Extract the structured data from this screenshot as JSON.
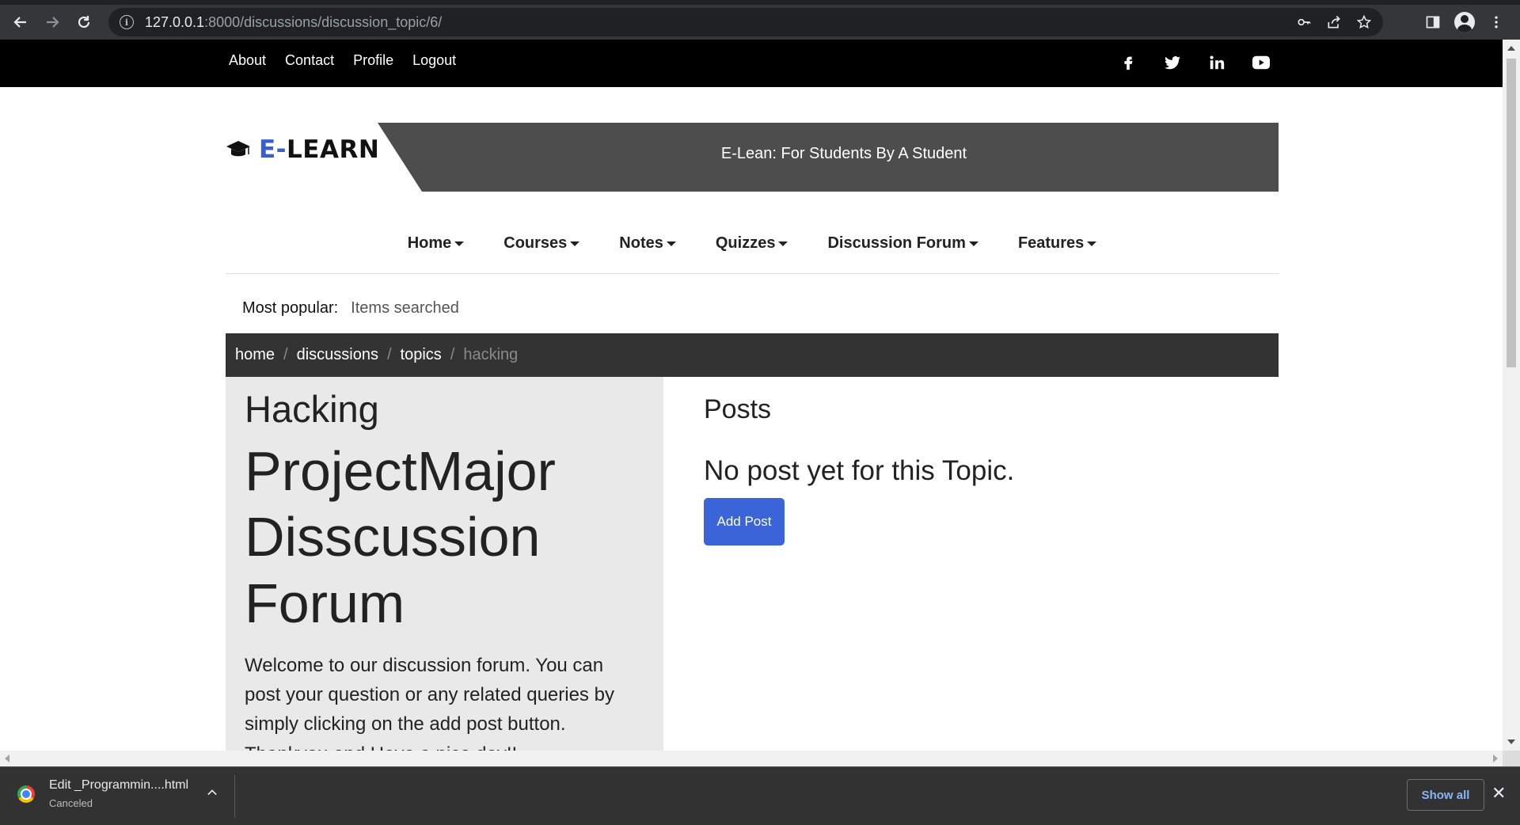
{
  "browser": {
    "url_host": "127.0.0.1",
    "url_path": ":8000/discussions/discussion_topic/6/"
  },
  "topbar": {
    "links": [
      "About",
      "Contact",
      "Profile",
      "Logout"
    ],
    "social_icons": [
      "facebook-icon",
      "twitter-icon",
      "linkedin-icon",
      "youtube-icon"
    ]
  },
  "brand": {
    "prefix": "E-",
    "name": "LEARN",
    "tagline": "E-Lean: For Students By A Student",
    "accent_color": "#3a5fcd"
  },
  "nav": {
    "items": [
      "Home",
      "Courses",
      "Notes",
      "Quizzes",
      "Discussion Forum",
      "Features"
    ]
  },
  "popular": {
    "label": "Most popular:",
    "value": "Items searched"
  },
  "breadcrumb": {
    "items": [
      "home",
      "discussions",
      "topics"
    ],
    "active": "hacking"
  },
  "topic": {
    "name": "Hacking",
    "heading": "ProjectMajor Disscussion Forum",
    "description": "Welcome to our discussion forum. You can post your question or any related queries by simply clicking on the add post button. Thankyou and Have a nice day!!"
  },
  "posts": {
    "title": "Posts",
    "empty_message": "No post yet for this Topic.",
    "add_button": "Add Post",
    "button_color": "#3a64d8"
  },
  "downloads": {
    "file_name": "Edit _Programmin....html",
    "status": "Canceled",
    "show_all": "Show all"
  }
}
